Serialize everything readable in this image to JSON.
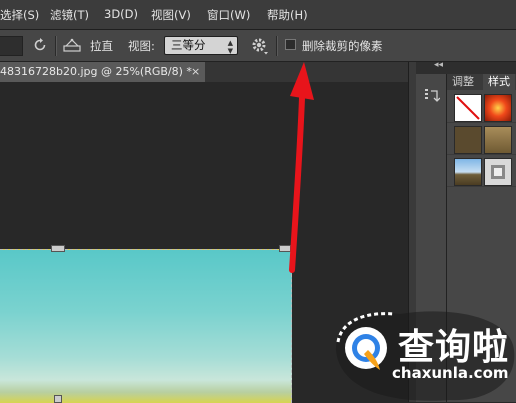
{
  "menubar": {
    "items": [
      "选择(S)",
      "滤镜(T)",
      "3D(D)",
      "视图(V)",
      "窗口(W)",
      "帮助(H)"
    ]
  },
  "options_bar": {
    "straighten_label": "拉直",
    "view_label": "视图:",
    "view_value": "三等分",
    "delete_cropped_label": "删除裁剪的像素",
    "delete_cropped_checked": false
  },
  "document_tab": {
    "title": "48316728b20.jpg @ 25%(RGB/8) *",
    "close": "×"
  },
  "panel": {
    "collapse_glyph": "◂◂",
    "tabs": [
      "调整",
      "样式"
    ],
    "active_tab": "样式"
  },
  "watermark": {
    "brand": "查询啦",
    "domain": "chaxunla.com",
    "accent": "#2f82e6"
  },
  "colors": {
    "annotation_arrow": "#e8141b",
    "menubar": "#3c3c3c",
    "canvas_bg": "#282828"
  }
}
